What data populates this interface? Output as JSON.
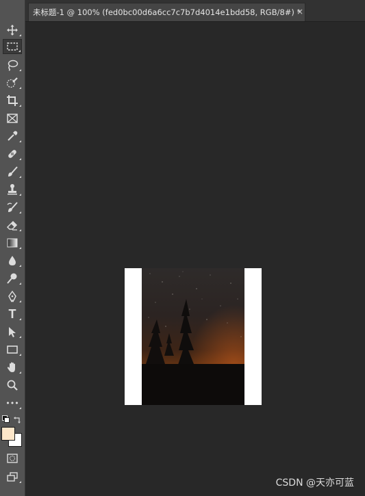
{
  "document_tab": {
    "title": "未标题-1 @ 100% (fed0bc00d6a6cc7c7b7d4014e1bdd58, RGB/8#) *",
    "close_glyph": "×"
  },
  "toolbar": {
    "tools": [
      {
        "name": "move-tool",
        "icon": "move-icon"
      },
      {
        "name": "rectangular-marquee-tool",
        "icon": "marquee-icon",
        "active": true
      },
      {
        "name": "lasso-tool",
        "icon": "lasso-icon"
      },
      {
        "name": "quick-selection-tool",
        "icon": "quick-selection-icon"
      },
      {
        "name": "crop-tool",
        "icon": "crop-icon"
      },
      {
        "name": "frame-tool",
        "icon": "frame-icon"
      },
      {
        "name": "eyedropper-tool",
        "icon": "eyedropper-icon"
      },
      {
        "name": "healing-brush-tool",
        "icon": "bandage-icon"
      },
      {
        "name": "brush-tool",
        "icon": "brush-icon"
      },
      {
        "name": "clone-stamp-tool",
        "icon": "stamp-icon"
      },
      {
        "name": "history-brush-tool",
        "icon": "history-brush-icon"
      },
      {
        "name": "eraser-tool",
        "icon": "eraser-icon"
      },
      {
        "name": "gradient-tool",
        "icon": "gradient-icon"
      },
      {
        "name": "blur-tool",
        "icon": "drop-icon"
      },
      {
        "name": "dodge-tool",
        "icon": "dodge-icon"
      },
      {
        "name": "pen-tool",
        "icon": "pen-icon"
      },
      {
        "name": "type-tool",
        "icon": "type-icon",
        "glyph": "T"
      },
      {
        "name": "path-selection-tool",
        "icon": "arrow-icon"
      },
      {
        "name": "rectangle-tool",
        "icon": "rectangle-icon"
      },
      {
        "name": "hand-tool",
        "icon": "hand-icon"
      },
      {
        "name": "zoom-tool",
        "icon": "zoom-icon"
      },
      {
        "name": "edit-toolbar",
        "icon": "more-icon",
        "glyph": "•••"
      }
    ],
    "foreground_color": "#fde6c9",
    "background_color": "#ffffff"
  },
  "canvas": {
    "background_color": "#282828",
    "document_color": "#ffffff"
  },
  "watermark": "CSDN @天亦可蓝"
}
